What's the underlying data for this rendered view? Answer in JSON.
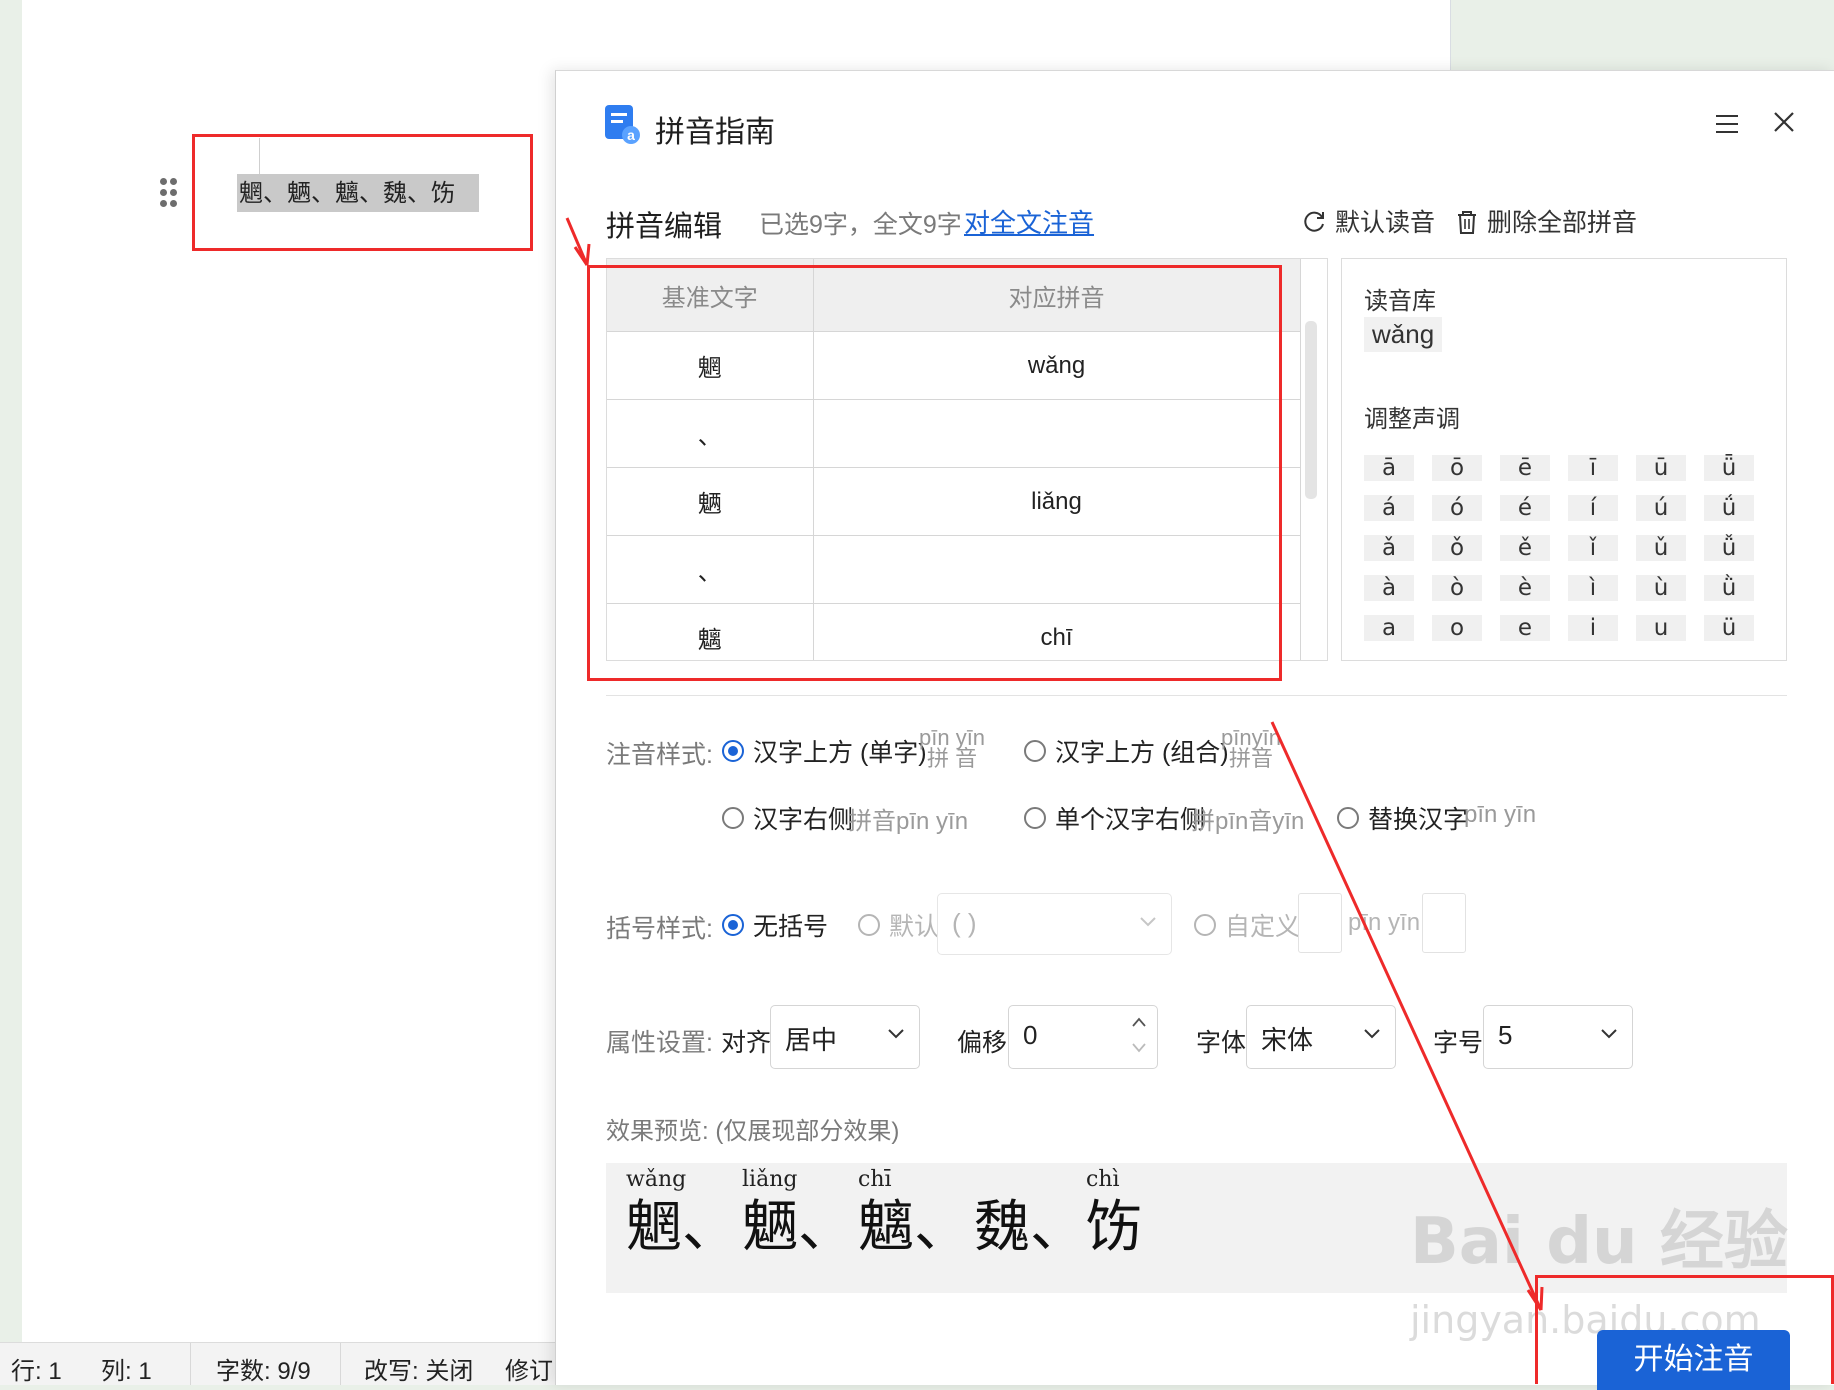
{
  "document": {
    "selected_text": "魍、魉、魑、魏、饬"
  },
  "status_bar": {
    "row": "行: 1",
    "col": "列: 1",
    "word_count": "字数: 9/9",
    "overtype": "改写: 关闭",
    "revision": "修订"
  },
  "dialog": {
    "title": "拼音指南",
    "section_title": "拼音编辑",
    "selection_info": "已选9字，全文9字",
    "annotate_all_link": "对全文注音",
    "default_reading_btn": "默认读音",
    "delete_all_btn": "删除全部拼音",
    "table": {
      "headers": [
        "基准文字",
        "对应拼音"
      ],
      "rows": [
        {
          "char": "魍",
          "pinyin": "wǎng"
        },
        {
          "char": "、",
          "pinyin": ""
        },
        {
          "char": "魉",
          "pinyin": "liǎng"
        },
        {
          "char": "、",
          "pinyin": ""
        },
        {
          "char": "魑",
          "pinyin": "chī"
        }
      ]
    },
    "library": {
      "label": "读音库",
      "reading": "wǎng",
      "tone_label": "调整声调",
      "tones": [
        [
          "ā",
          "ō",
          "ē",
          "ī",
          "ū",
          "ǖ"
        ],
        [
          "á",
          "ó",
          "é",
          "í",
          "ú",
          "ǘ"
        ],
        [
          "ǎ",
          "ǒ",
          "ě",
          "ǐ",
          "ǔ",
          "ǚ"
        ],
        [
          "à",
          "ò",
          "è",
          "ì",
          "ù",
          "ǜ"
        ],
        [
          "a",
          "o",
          "e",
          "i",
          "u",
          "ü"
        ]
      ]
    },
    "style_row": {
      "label": "注音样式:",
      "opt_above_single": "汉字上方 (单字)",
      "sample_above_single_py": "pīn yīn",
      "sample_above_single_hz": "拼 音",
      "opt_above_combined": "汉字上方 (组合)",
      "sample_above_combined_py": "pīnyīn",
      "sample_above_combined_hz": "拼音",
      "opt_right": "汉字右侧",
      "sample_right": "拼音pīn yīn",
      "opt_single_right": "单个汉字右侧",
      "sample_single_right": "拼pīn音yīn",
      "opt_replace": "替换汉字",
      "sample_replace": "pīn yīn",
      "selected": "above_single"
    },
    "bracket_row": {
      "label": "括号样式:",
      "opt_none": "无括号",
      "opt_default": "默认",
      "default_value": "( )",
      "opt_custom": "自定义",
      "custom_sample": "pīn yīn",
      "selected": "none"
    },
    "attr_row": {
      "label": "属性设置:",
      "align_label": "对齐",
      "align_value": "居中",
      "offset_label": "偏移",
      "offset_value": "0",
      "font_label": "字体",
      "font_value": "宋体",
      "size_label": "字号",
      "size_value": "5"
    },
    "preview": {
      "label": "效果预览:  (仅展现部分效果)",
      "items": [
        {
          "py": "wǎng",
          "hz": "魍、"
        },
        {
          "py": "liǎng",
          "hz": "魉、"
        },
        {
          "py": "chī",
          "hz": "魑、"
        },
        {
          "py": "",
          "hz": "魏、"
        },
        {
          "py": "chì",
          "hz": "饬"
        }
      ]
    },
    "start_button": "开始注音"
  },
  "watermark": {
    "main": "Bai du 经验",
    "sub": "jingyan.baidu.com"
  },
  "colors": {
    "accent": "#1a63d6",
    "annotation_red": "#ee2a2a"
  }
}
